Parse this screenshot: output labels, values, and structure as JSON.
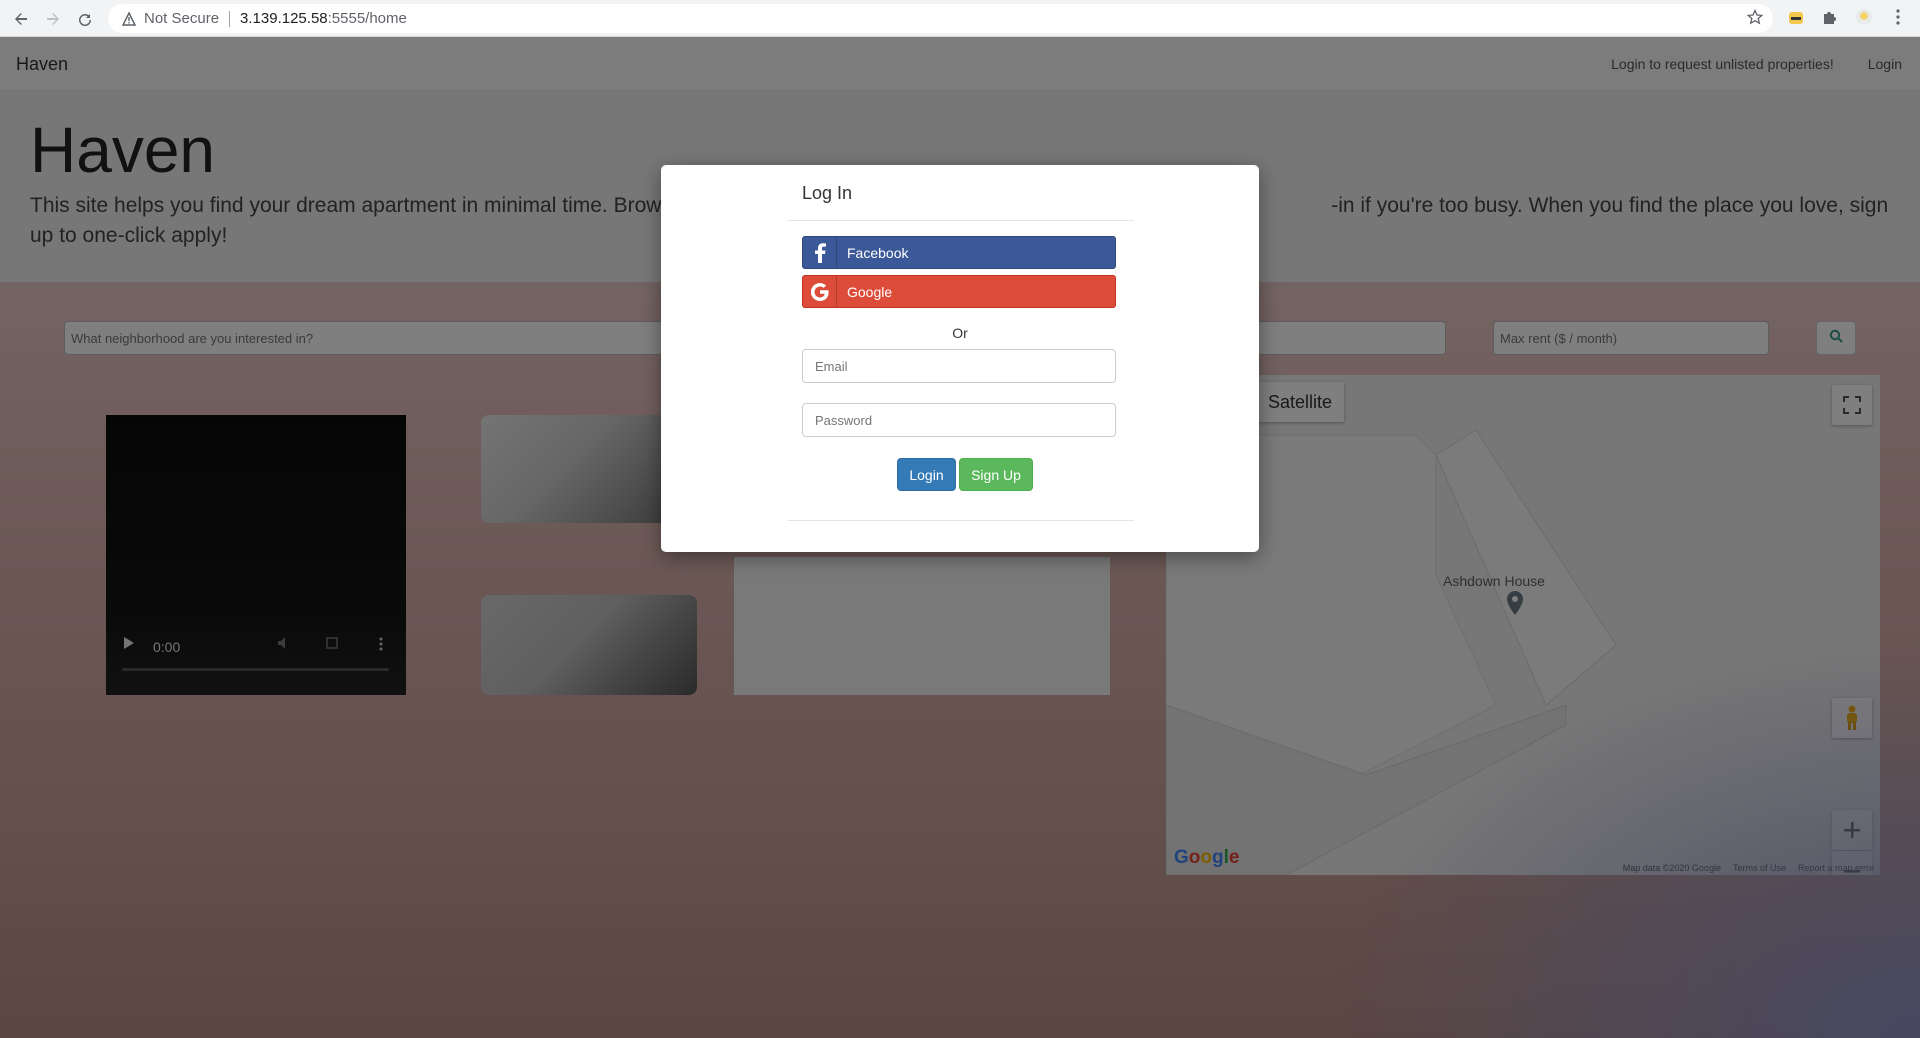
{
  "browser": {
    "security_label": "Not Secure",
    "url_host": "3.139.125.58",
    "url_path": ":5555/home"
  },
  "navbar": {
    "brand": "Haven",
    "links": [
      "Login to request unlisted properties!",
      "Login"
    ]
  },
  "hero": {
    "title": "Haven",
    "text": "This site helps you find your dream apartment in minimal time. Browse                                                                                                               -in if you're too busy. When you find the place you love, sign up to one-click apply!"
  },
  "search": {
    "neighborhood_placeholder": "What neighborhood are you interested in?",
    "max_rent_placeholder": "Max rent ($ / month)"
  },
  "video": {
    "time": "0:00"
  },
  "map": {
    "map_type": "Satellite",
    "poi_label": "Ashdown House",
    "attribution": [
      "Map data ©2020 Google",
      "Terms of Use",
      "Report a map error"
    ],
    "logo": "Google"
  },
  "modal": {
    "title": "Log In",
    "facebook_label": "Facebook",
    "google_label": "Google",
    "or_label": "Or",
    "email_placeholder": "Email",
    "password_placeholder": "Password",
    "login_label": "Login",
    "signup_label": "Sign Up"
  },
  "colors": {
    "facebook": "#3b5998",
    "google": "#dd4b39",
    "login": "#337ab7",
    "signup": "#5cb85c"
  }
}
